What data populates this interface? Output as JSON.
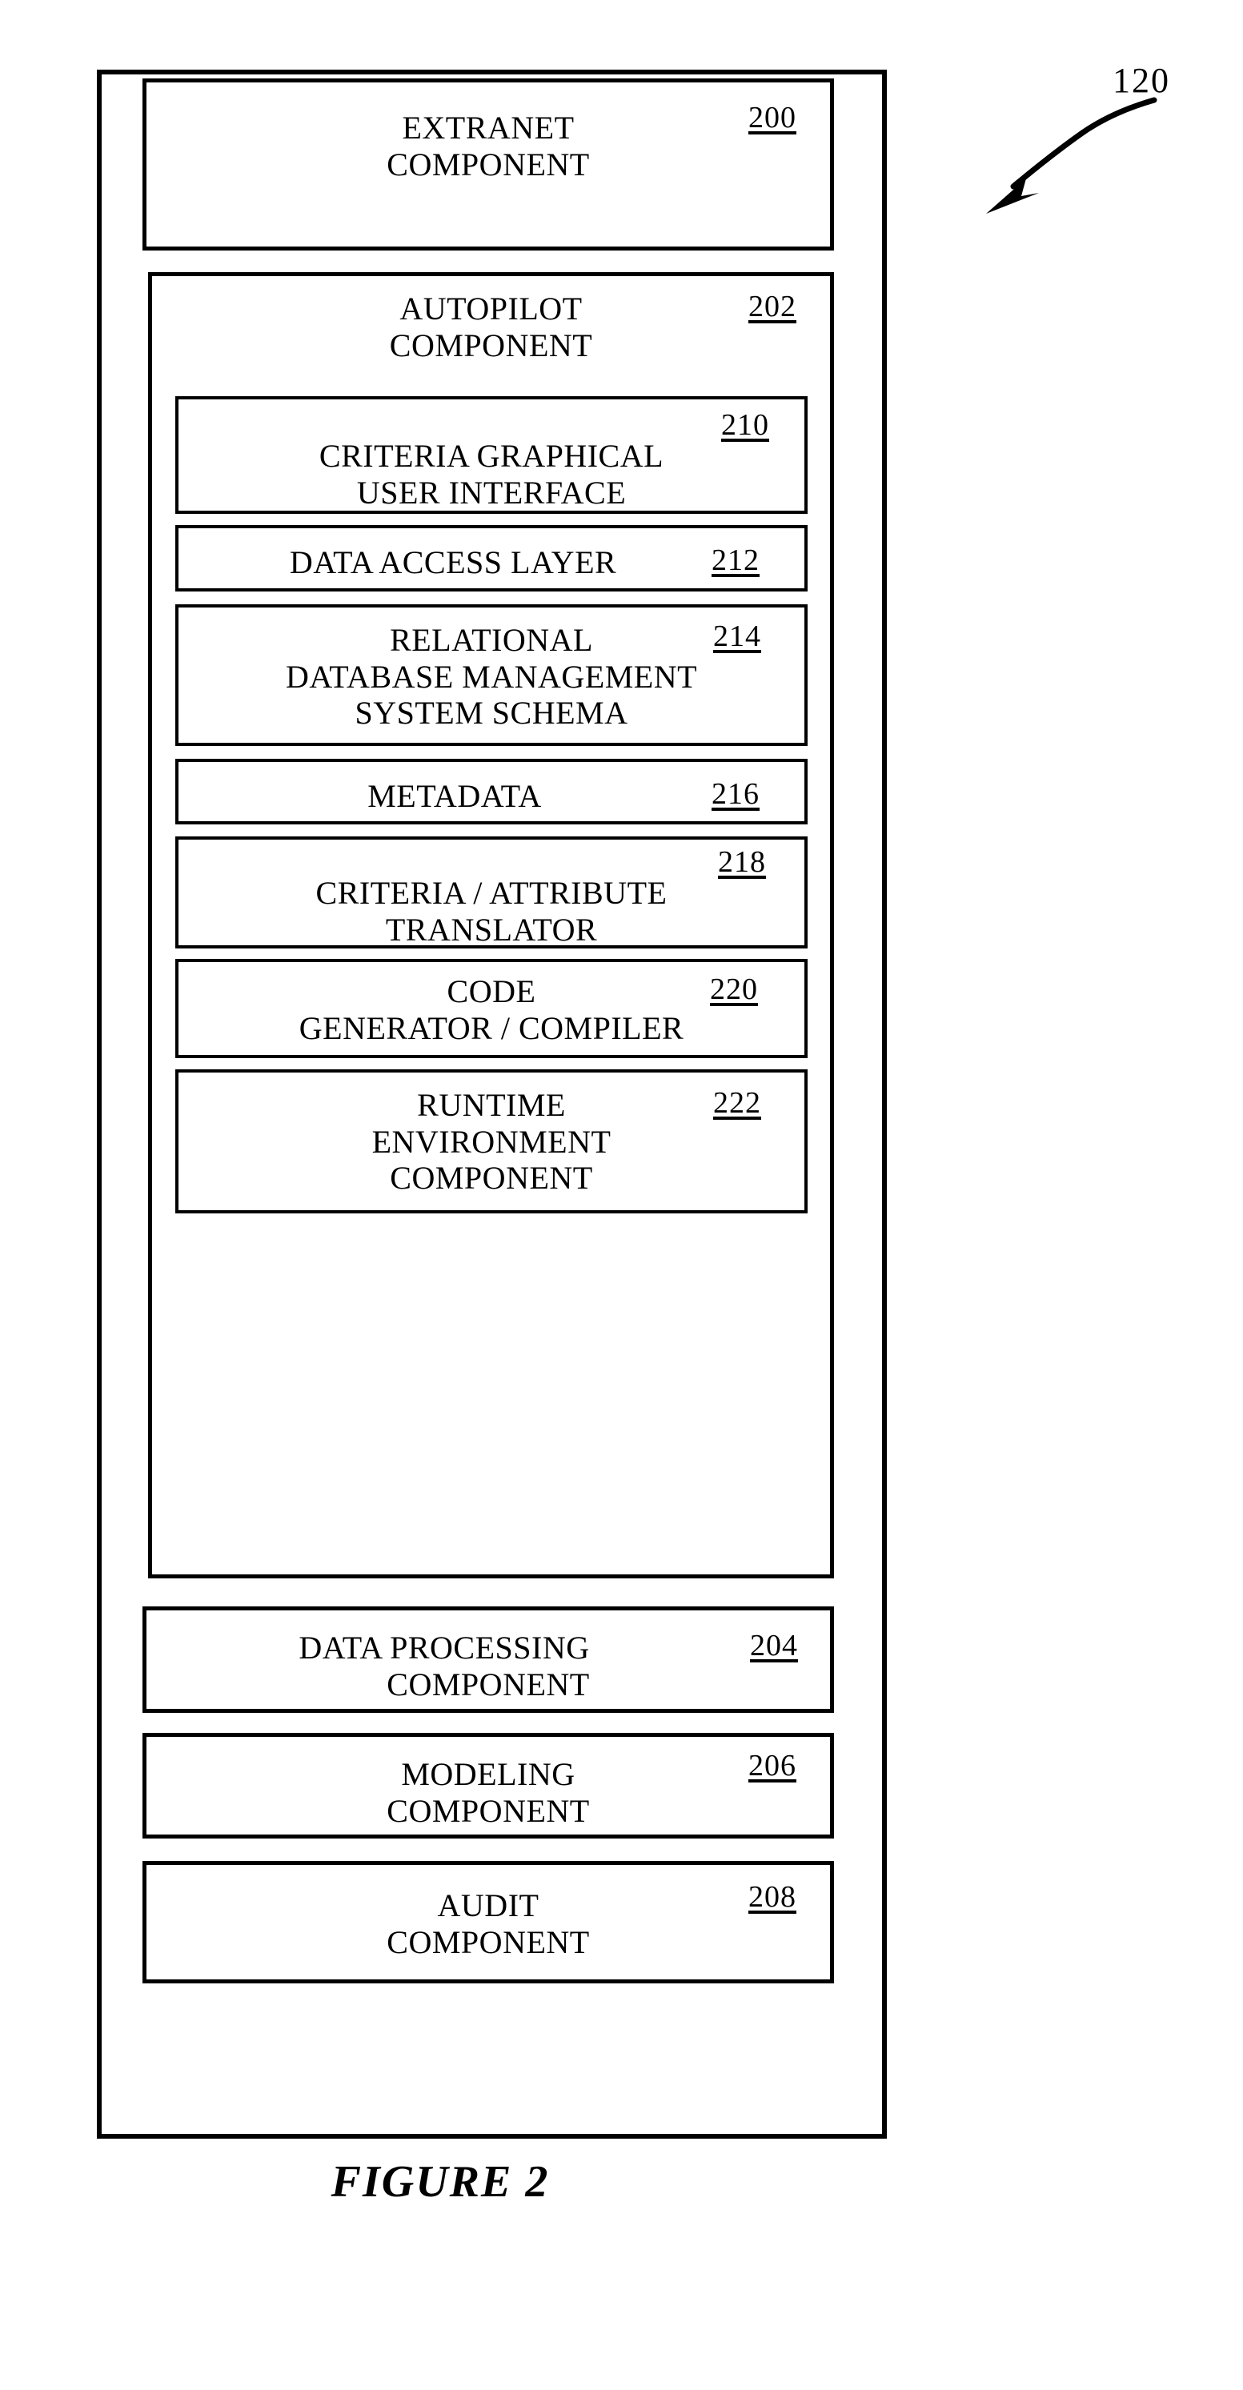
{
  "figure": {
    "caption": "FIGURE 2",
    "system_callout": "120"
  },
  "boxes": {
    "extranet": {
      "lines": [
        "EXTRANET",
        "COMPONENT"
      ],
      "ref": "200"
    },
    "autopilot": {
      "lines": [
        "AUTOPILOT",
        "COMPONENT"
      ],
      "ref": "202"
    },
    "cgui": {
      "lines": [
        "CRITERIA GRAPHICAL",
        "USER INTERFACE"
      ],
      "ref": "210"
    },
    "dal": {
      "lines": [
        "DATA ACCESS LAYER"
      ],
      "ref": "212"
    },
    "rdbms": {
      "lines": [
        "RELATIONAL",
        "DATABASE MANAGEMENT",
        "SYSTEM SCHEMA"
      ],
      "ref": "214"
    },
    "metadata": {
      "lines": [
        "METADATA"
      ],
      "ref": "216"
    },
    "catrans": {
      "lines": [
        "CRITERIA / ATTRIBUTE",
        "TRANSLATOR"
      ],
      "ref": "218"
    },
    "codegen": {
      "lines": [
        "CODE",
        "GENERATOR / COMPILER"
      ],
      "ref": "220"
    },
    "runtime": {
      "lines": [
        "RUNTIME",
        "ENVIRONMENT",
        "COMPONENT"
      ],
      "ref": "222"
    },
    "dataproc": {
      "lines": [
        "DATA PROCESSING",
        "COMPONENT"
      ],
      "ref": "204"
    },
    "modeling": {
      "lines": [
        "MODELING",
        "COMPONENT"
      ],
      "ref": "206"
    },
    "audit": {
      "lines": [
        "AUDIT",
        "COMPONENT"
      ],
      "ref": "208"
    }
  },
  "colors": {
    "ink": "#000000",
    "paper": "#ffffff"
  }
}
